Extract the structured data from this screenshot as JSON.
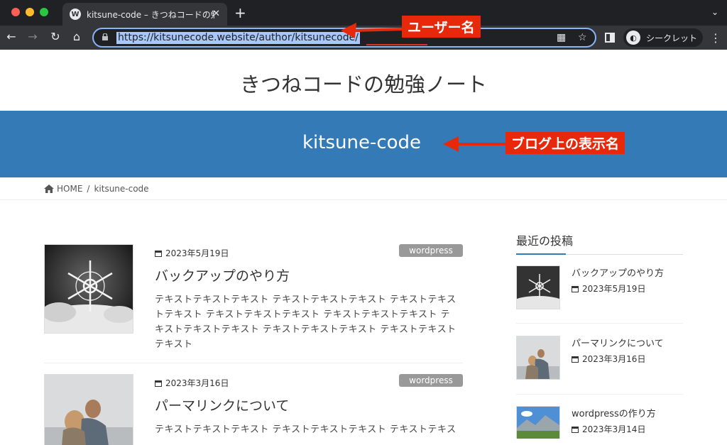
{
  "browser": {
    "tab_title": "kitsune-code – きつねコードの勉強ノート",
    "tab_icon": "W",
    "url_prefix": "https://kitsunecode.website/author/",
    "url_user": "kitsunecode/",
    "profile_label": "シークレット",
    "new_tab": "+",
    "close": "✕"
  },
  "site": {
    "title": "きつねコードの勉強ノート",
    "author_display": "kitsune-code"
  },
  "breadcrumb": {
    "home": "HOME",
    "sep": "/",
    "current": "kitsune-code"
  },
  "posts": [
    {
      "date": "2023年5月19日",
      "tag": "wordpress",
      "title": "バックアップのやり方",
      "excerpt": "テキストテキストテキスト テキストテキストテキスト テキストテキストテキスト テキストテキストテキスト テキストテキストテキスト テキストテキストテキスト テキストテキストテキスト テキストテキストテキスト"
    },
    {
      "date": "2023年3月16日",
      "tag": "wordpress",
      "title": "パーマリンクについて",
      "excerpt": "テキストテキストテキスト テキストテキストテキスト テキストテキス"
    }
  ],
  "sidebar": {
    "heading": "最近の投稿",
    "items": [
      {
        "title": "バックアップのやり方",
        "date": "2023年5月19日"
      },
      {
        "title": "パーマリンクについて",
        "date": "2023年3月16日"
      },
      {
        "title": "wordpressの作り方",
        "date": "2023年3月14日"
      }
    ]
  },
  "annotations": {
    "username_label": "ユーザー名",
    "display_name_label": "ブログ上の表示名"
  },
  "colors": {
    "banner": "#337ab7",
    "callout": "#e8280a",
    "chrome_dark": "#202124"
  }
}
